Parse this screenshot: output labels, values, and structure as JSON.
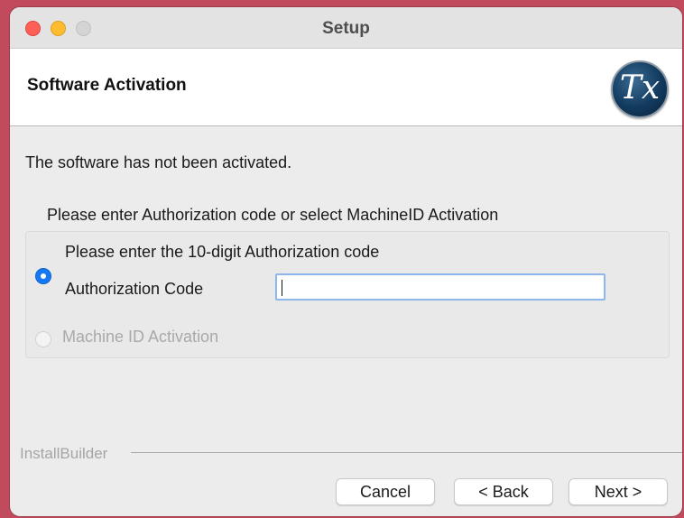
{
  "window": {
    "title": "Setup"
  },
  "header": {
    "title": "Software Activation",
    "logo_text": "Tx",
    "logo_icon": "tx-logo-icon"
  },
  "body": {
    "status_text": "The software has not been activated.",
    "instruction": "Please enter Authorization code or select MachineID Activation"
  },
  "activation": {
    "hint": "Please enter the 10-digit Authorization code",
    "auth_option": {
      "label": "Authorization Code",
      "selected": true,
      "value": ""
    },
    "machine_option": {
      "label": "Machine ID Activation",
      "selected": false,
      "enabled": false
    }
  },
  "footer": {
    "brand": "InstallBuilder",
    "buttons": {
      "cancel": "Cancel",
      "back": "< Back",
      "next": "Next >"
    }
  },
  "colors": {
    "accent": "#1579f6",
    "focus_ring": "#8db7ea",
    "close": "#fe5f57",
    "minimize": "#febc2e"
  }
}
